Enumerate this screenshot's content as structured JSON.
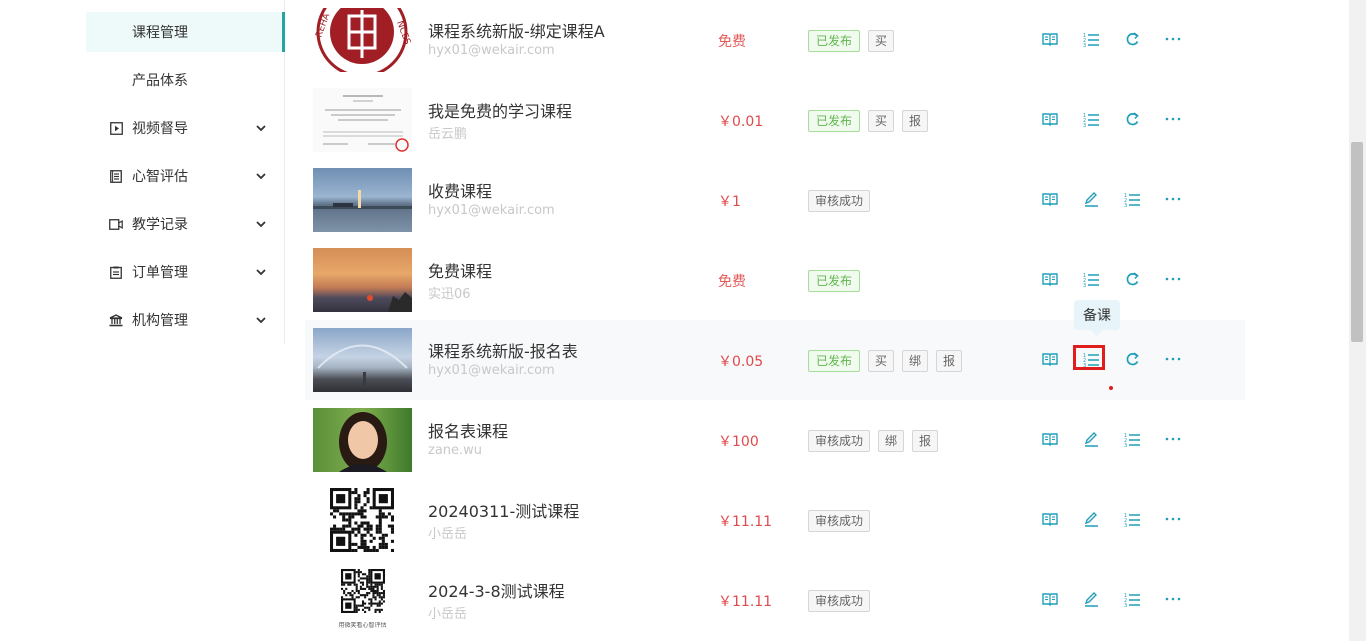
{
  "sidebar": {
    "items": [
      {
        "label": "课程管理",
        "icon": "none",
        "active": true,
        "has_chevron": false
      },
      {
        "label": "产品体系",
        "icon": "none",
        "active": false,
        "has_chevron": false
      },
      {
        "label": "视频督导",
        "icon": "play-square-icon",
        "active": false,
        "has_chevron": true
      },
      {
        "label": "心智评估",
        "icon": "list-square-icon",
        "active": false,
        "has_chevron": true
      },
      {
        "label": "教学记录",
        "icon": "video-camera-icon",
        "active": false,
        "has_chevron": true
      },
      {
        "label": "订单管理",
        "icon": "clipboard-icon",
        "active": false,
        "has_chevron": true
      },
      {
        "label": "机构管理",
        "icon": "institution-icon",
        "active": false,
        "has_chevron": true
      }
    ]
  },
  "courses": [
    {
      "title": "课程系统新版-绑定课程A",
      "author": "hyx01@wekair.com",
      "price": "免费",
      "tags": [
        "已发布",
        "买"
      ],
      "actions": [
        "book",
        "list",
        "refresh",
        "more"
      ]
    },
    {
      "title": "我是免费的学习课程",
      "author": "岳云鹏",
      "price": "￥0.01",
      "tags": [
        "已发布",
        "买",
        "报"
      ],
      "actions": [
        "book",
        "list",
        "refresh",
        "more"
      ]
    },
    {
      "title": "收费课程",
      "author": "hyx01@wekair.com",
      "price": "￥1",
      "tags": [
        "审核成功"
      ],
      "actions": [
        "book",
        "edit",
        "list",
        "more"
      ]
    },
    {
      "title": "免费课程",
      "author": "实迅06",
      "price": "免费",
      "tags": [
        "已发布"
      ],
      "actions": [
        "book",
        "list",
        "refresh",
        "more"
      ]
    },
    {
      "title": "课程系统新版-报名表",
      "author": "hyx01@wekair.com",
      "price": "￥0.05",
      "tags": [
        "已发布",
        "买",
        "绑",
        "报"
      ],
      "actions": [
        "book",
        "list",
        "refresh",
        "more"
      ]
    },
    {
      "title": "报名表课程",
      "author": "zane.wu",
      "price": "￥100",
      "tags": [
        "审核成功",
        "绑",
        "报"
      ],
      "actions": [
        "book",
        "edit",
        "list",
        "more"
      ]
    },
    {
      "title": "20240311-测试课程",
      "author": "小岳岳",
      "price": "￥11.11",
      "tags": [
        "审核成功"
      ],
      "actions": [
        "book",
        "edit",
        "list",
        "more"
      ]
    },
    {
      "title": "2024-3-8测试课程",
      "author": "小岳岳",
      "price": "￥11.11",
      "tags": [
        "审核成功"
      ],
      "actions": [
        "book",
        "edit",
        "list",
        "more"
      ]
    }
  ],
  "thumbnail_captions": {
    "qr2": "用微笑看心智评估"
  },
  "tooltip": {
    "text": "备课"
  },
  "colors": {
    "accent": "#21a6a2",
    "icon": "#1f9fb8",
    "price": "#e04a4a",
    "published": "#5fb84d",
    "highlight": "#e01e1e"
  }
}
